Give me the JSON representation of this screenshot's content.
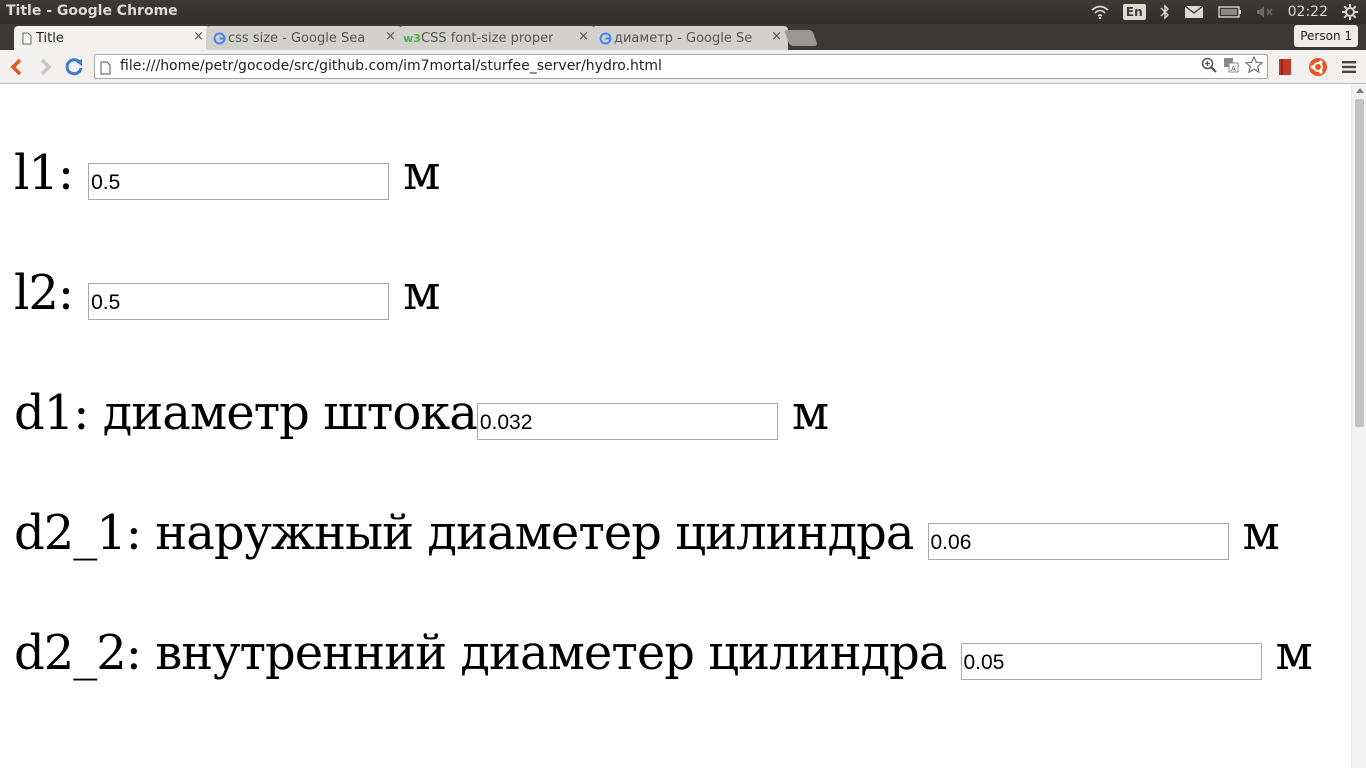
{
  "os_panel": {
    "window_title": "Title - Google Chrome",
    "keyboard_layout": "En",
    "clock": "02:22"
  },
  "tabs": [
    {
      "label": "Title",
      "favicon": "page-icon",
      "active": true
    },
    {
      "label": "css size - Google Sea",
      "favicon": "google-icon",
      "active": false
    },
    {
      "label": "CSS font-size proper",
      "favicon": "w3schools-icon",
      "active": false
    },
    {
      "label": "диаметр - Google Se",
      "favicon": "google-icon",
      "active": false
    }
  ],
  "tab_close_glyph": "×",
  "profile": {
    "label": "Person 1"
  },
  "toolbar": {
    "url": "file:///home/petr/gocode/src/github.com/im7mortal/sturfee_server/hydro.html"
  },
  "form": {
    "rows": [
      {
        "label": "l1:",
        "value": "0.5",
        "unit": "м"
      },
      {
        "label": "l2:",
        "value": "0.5",
        "unit": "м"
      },
      {
        "label": "d1: диаметр штока",
        "value": "0.032",
        "unit": "м"
      },
      {
        "label": "d2_1: наружный диаметер цилиндра",
        "value": "0.06",
        "unit": "м"
      },
      {
        "label": "d2_2: внутренний диаметер цилиндра",
        "value": "0.05",
        "unit": "м"
      }
    ]
  },
  "colors": {
    "panel_bg": "#3c3b37",
    "back_arrow": "#e05a1c",
    "reload": "#3b7bd8",
    "ubuntu_orange": "#e95420",
    "bookmark_red": "#c0392b"
  }
}
